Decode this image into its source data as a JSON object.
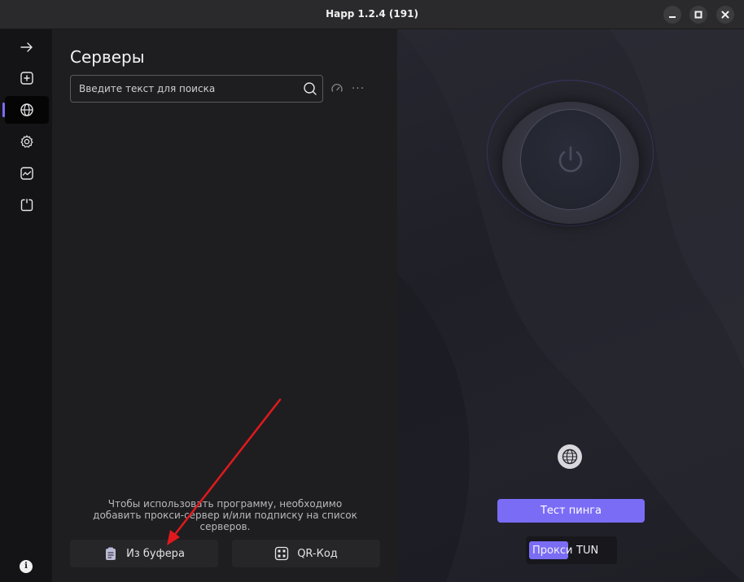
{
  "window": {
    "title": "Happ 1.2.4 (191)",
    "buttons": [
      "minimize",
      "maximize",
      "close"
    ]
  },
  "sidebar": {
    "items": [
      {
        "icon": "arrow-right-icon",
        "active": false
      },
      {
        "icon": "plus-square-icon",
        "active": false
      },
      {
        "icon": "globe-icon",
        "active": true
      },
      {
        "icon": "gear-icon",
        "active": false
      },
      {
        "icon": "chart-monitor-icon",
        "active": false
      },
      {
        "icon": "power-frame-icon",
        "active": false
      }
    ],
    "info_icon": "info-icon",
    "info_symbol": "i"
  },
  "servers": {
    "title": "Серверы",
    "search_placeholder": "Введите текст для поиска",
    "more_symbol": "···",
    "empty_message": "Чтобы использовать программу, необходимо добавить прокси-сервер и/или подписку на список серверов.",
    "add_from_clipboard": "Из буфера",
    "add_qr": "QR-Код"
  },
  "connect": {
    "ping_button": "Тест пинга",
    "modes": [
      "Прокси",
      "TUN"
    ],
    "active_mode": "Прокси"
  },
  "colors": {
    "accent": "#7b6cf6",
    "annotation": "#e0191e"
  }
}
